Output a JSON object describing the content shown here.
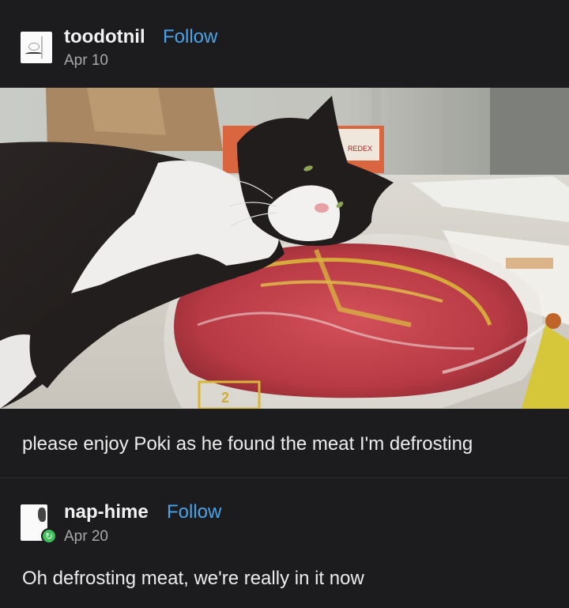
{
  "post": {
    "username": "toodotnil",
    "follow_label": "Follow",
    "date": "Apr 10",
    "caption": "please enjoy Poki as he found the meat I'm defrosting"
  },
  "reblog": {
    "username": "nap-hime",
    "follow_label": "Follow",
    "date": "Apr 20",
    "text": "Oh defrosting meat, we're really in it now"
  },
  "photo_labels": {
    "box_text": "REDEX",
    "package_code": "2"
  },
  "colors": {
    "background": "#1c1c1e",
    "follow_link": "#4aa3e8",
    "reblog_badge": "#3fbf5a"
  },
  "icons": {
    "reblog": "reblog-icon"
  }
}
